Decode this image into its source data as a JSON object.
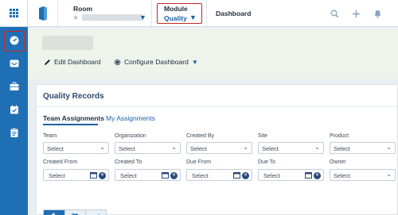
{
  "topbar": {
    "room_label": "Room",
    "module_label": "Module",
    "module_value": "Quality",
    "breadcrumb": "Dashboard",
    "icons": [
      "grid-icon",
      "logo-icon",
      "star-icon",
      "search-icon",
      "plus-icon",
      "bell-icon"
    ]
  },
  "sidebar": {
    "items": [
      {
        "icon": "dashboard-gauge-icon",
        "active": true
      },
      {
        "icon": "inbox-icon"
      },
      {
        "icon": "briefcase-icon"
      },
      {
        "icon": "calendar-check-icon"
      },
      {
        "icon": "clipboard-icon"
      }
    ]
  },
  "header": {
    "edit_label": "Edit Dashboard",
    "configure_label": "Configure Dashboard"
  },
  "card": {
    "title": "Quality Records",
    "tabs": [
      "Team Assignments",
      "My Assignments"
    ],
    "active_tab": "Team Assignments",
    "row1": [
      {
        "label": "Team",
        "value": "Select"
      },
      {
        "label": "Organization",
        "value": "Select"
      },
      {
        "label": "Created By",
        "value": "Select"
      },
      {
        "label": "Site",
        "value": "Select"
      },
      {
        "label": "Product",
        "value": "Select"
      }
    ],
    "row2": [
      {
        "label": "Created From",
        "value": "Select",
        "kind": "date"
      },
      {
        "label": "Created To",
        "value": "Select",
        "kind": "date"
      },
      {
        "label": "Due From",
        "value": "Select",
        "kind": "date"
      },
      {
        "label": "Due To",
        "value": "Select",
        "kind": "date"
      },
      {
        "label": "Owner",
        "value": "Select",
        "kind": "select"
      }
    ],
    "view_toggle": [
      "pie-chart-icon",
      "bar-horizontal-icon",
      "area-chart-icon"
    ]
  },
  "colors": {
    "primary": "#1f6fb5",
    "highlight": "#c62828",
    "header_band": "#eef3ec"
  }
}
